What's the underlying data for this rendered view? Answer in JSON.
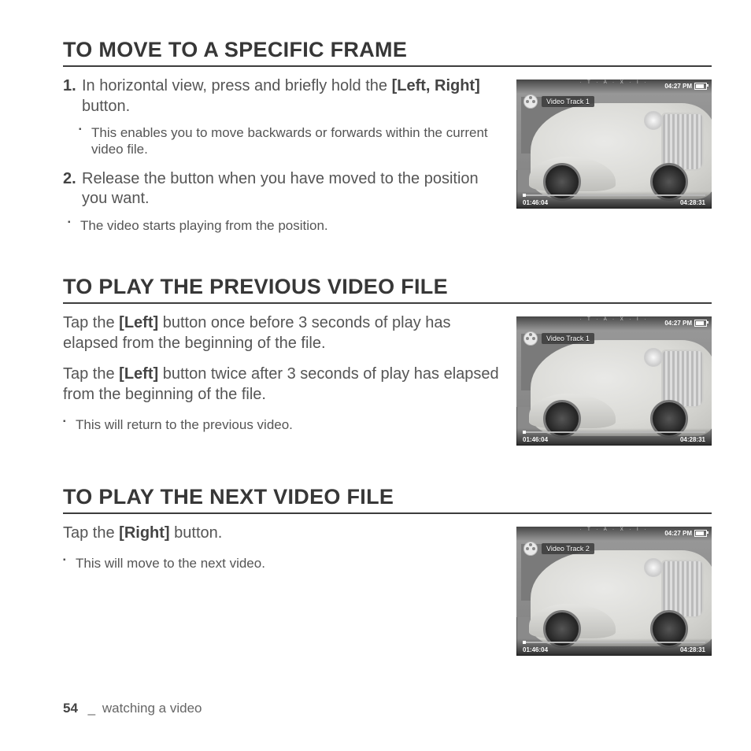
{
  "headings": {
    "sec1": "TO MOVE TO A SPECIFIC FRAME",
    "sec2": "TO PLAY THE PREVIOUS VIDEO FILE",
    "sec3": "TO PLAY THE NEXT VIDEO FILE"
  },
  "sec1": {
    "step1_num": "1.",
    "step1_a": "In horizontal view, press and briefly hold the ",
    "step1_bold": "[Left, Right]",
    "step1_b": " button.",
    "step1_sub": "This enables you to move backwards or forwards within the current video file.",
    "step2_num": "2.",
    "step2_a": "Release the button when you have moved to the position you want.",
    "step2_sub": "The video starts playing from the position."
  },
  "sec2": {
    "p1_a": "Tap the ",
    "p1_bold": "[Left]",
    "p1_b": " button once before 3 seconds of play has elapsed from the beginning of the file.",
    "p2_a": "Tap the ",
    "p2_bold": "[Left]",
    "p2_b": " button twice after 3 seconds of play has elapsed from the beginning of the file.",
    "bullet": "This will return to the previous video."
  },
  "sec3": {
    "p1_a": "Tap the ",
    "p1_bold": "[Right]",
    "p1_b": " button.",
    "bullet": "This will move to the next video."
  },
  "thumbs": {
    "t1": {
      "track": "Video Track 1",
      "clock": "04:27 PM",
      "taxi": "· T · A · X · I ·",
      "elapsed": "01:46:04",
      "total": "04:28:31"
    },
    "t2": {
      "track": "Video Track 1",
      "clock": "04:27 PM",
      "taxi": "· T · A · X · I ·",
      "elapsed": "01:46:04",
      "total": "04:28:31"
    },
    "t3": {
      "track": "Video Track 2",
      "clock": "04:27 PM",
      "taxi": "· T · A · X · I ·",
      "elapsed": "01:46:04",
      "total": "04:28:31"
    }
  },
  "footer": {
    "page": "54",
    "sep": "_",
    "chapter": "watching a video"
  }
}
